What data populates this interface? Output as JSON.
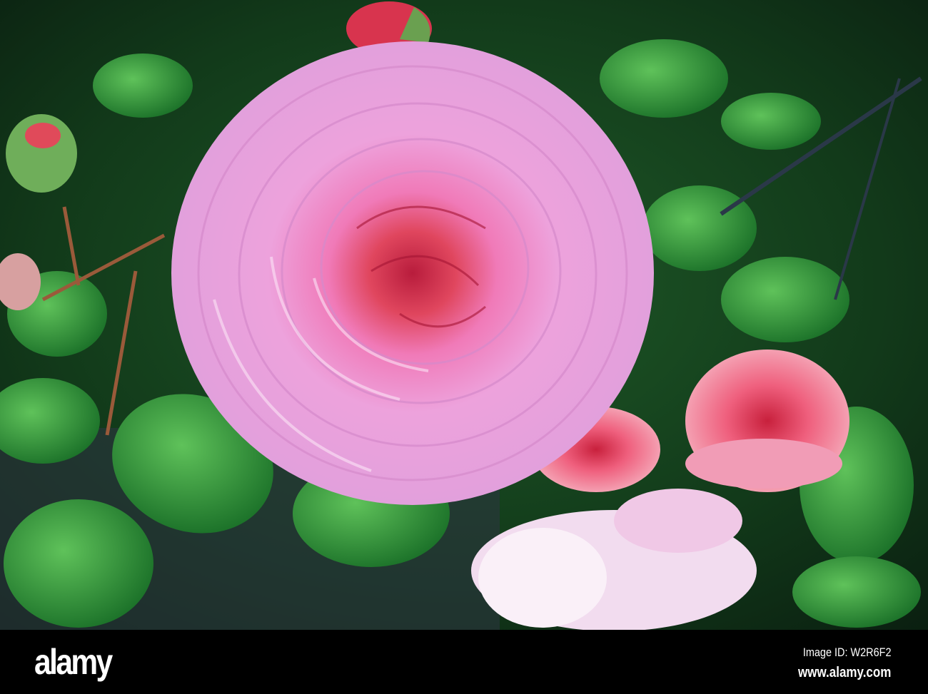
{
  "photo": {
    "subject": "pink-rose",
    "colors": {
      "petal": "#e9a6de",
      "center": "#e0465e",
      "leaf": "#1f7a2c",
      "background": "#0d2a14"
    }
  },
  "footer": {
    "logo": "alamy",
    "image_id": "Image ID: W2R6F2",
    "website": "www.alamy.com"
  }
}
